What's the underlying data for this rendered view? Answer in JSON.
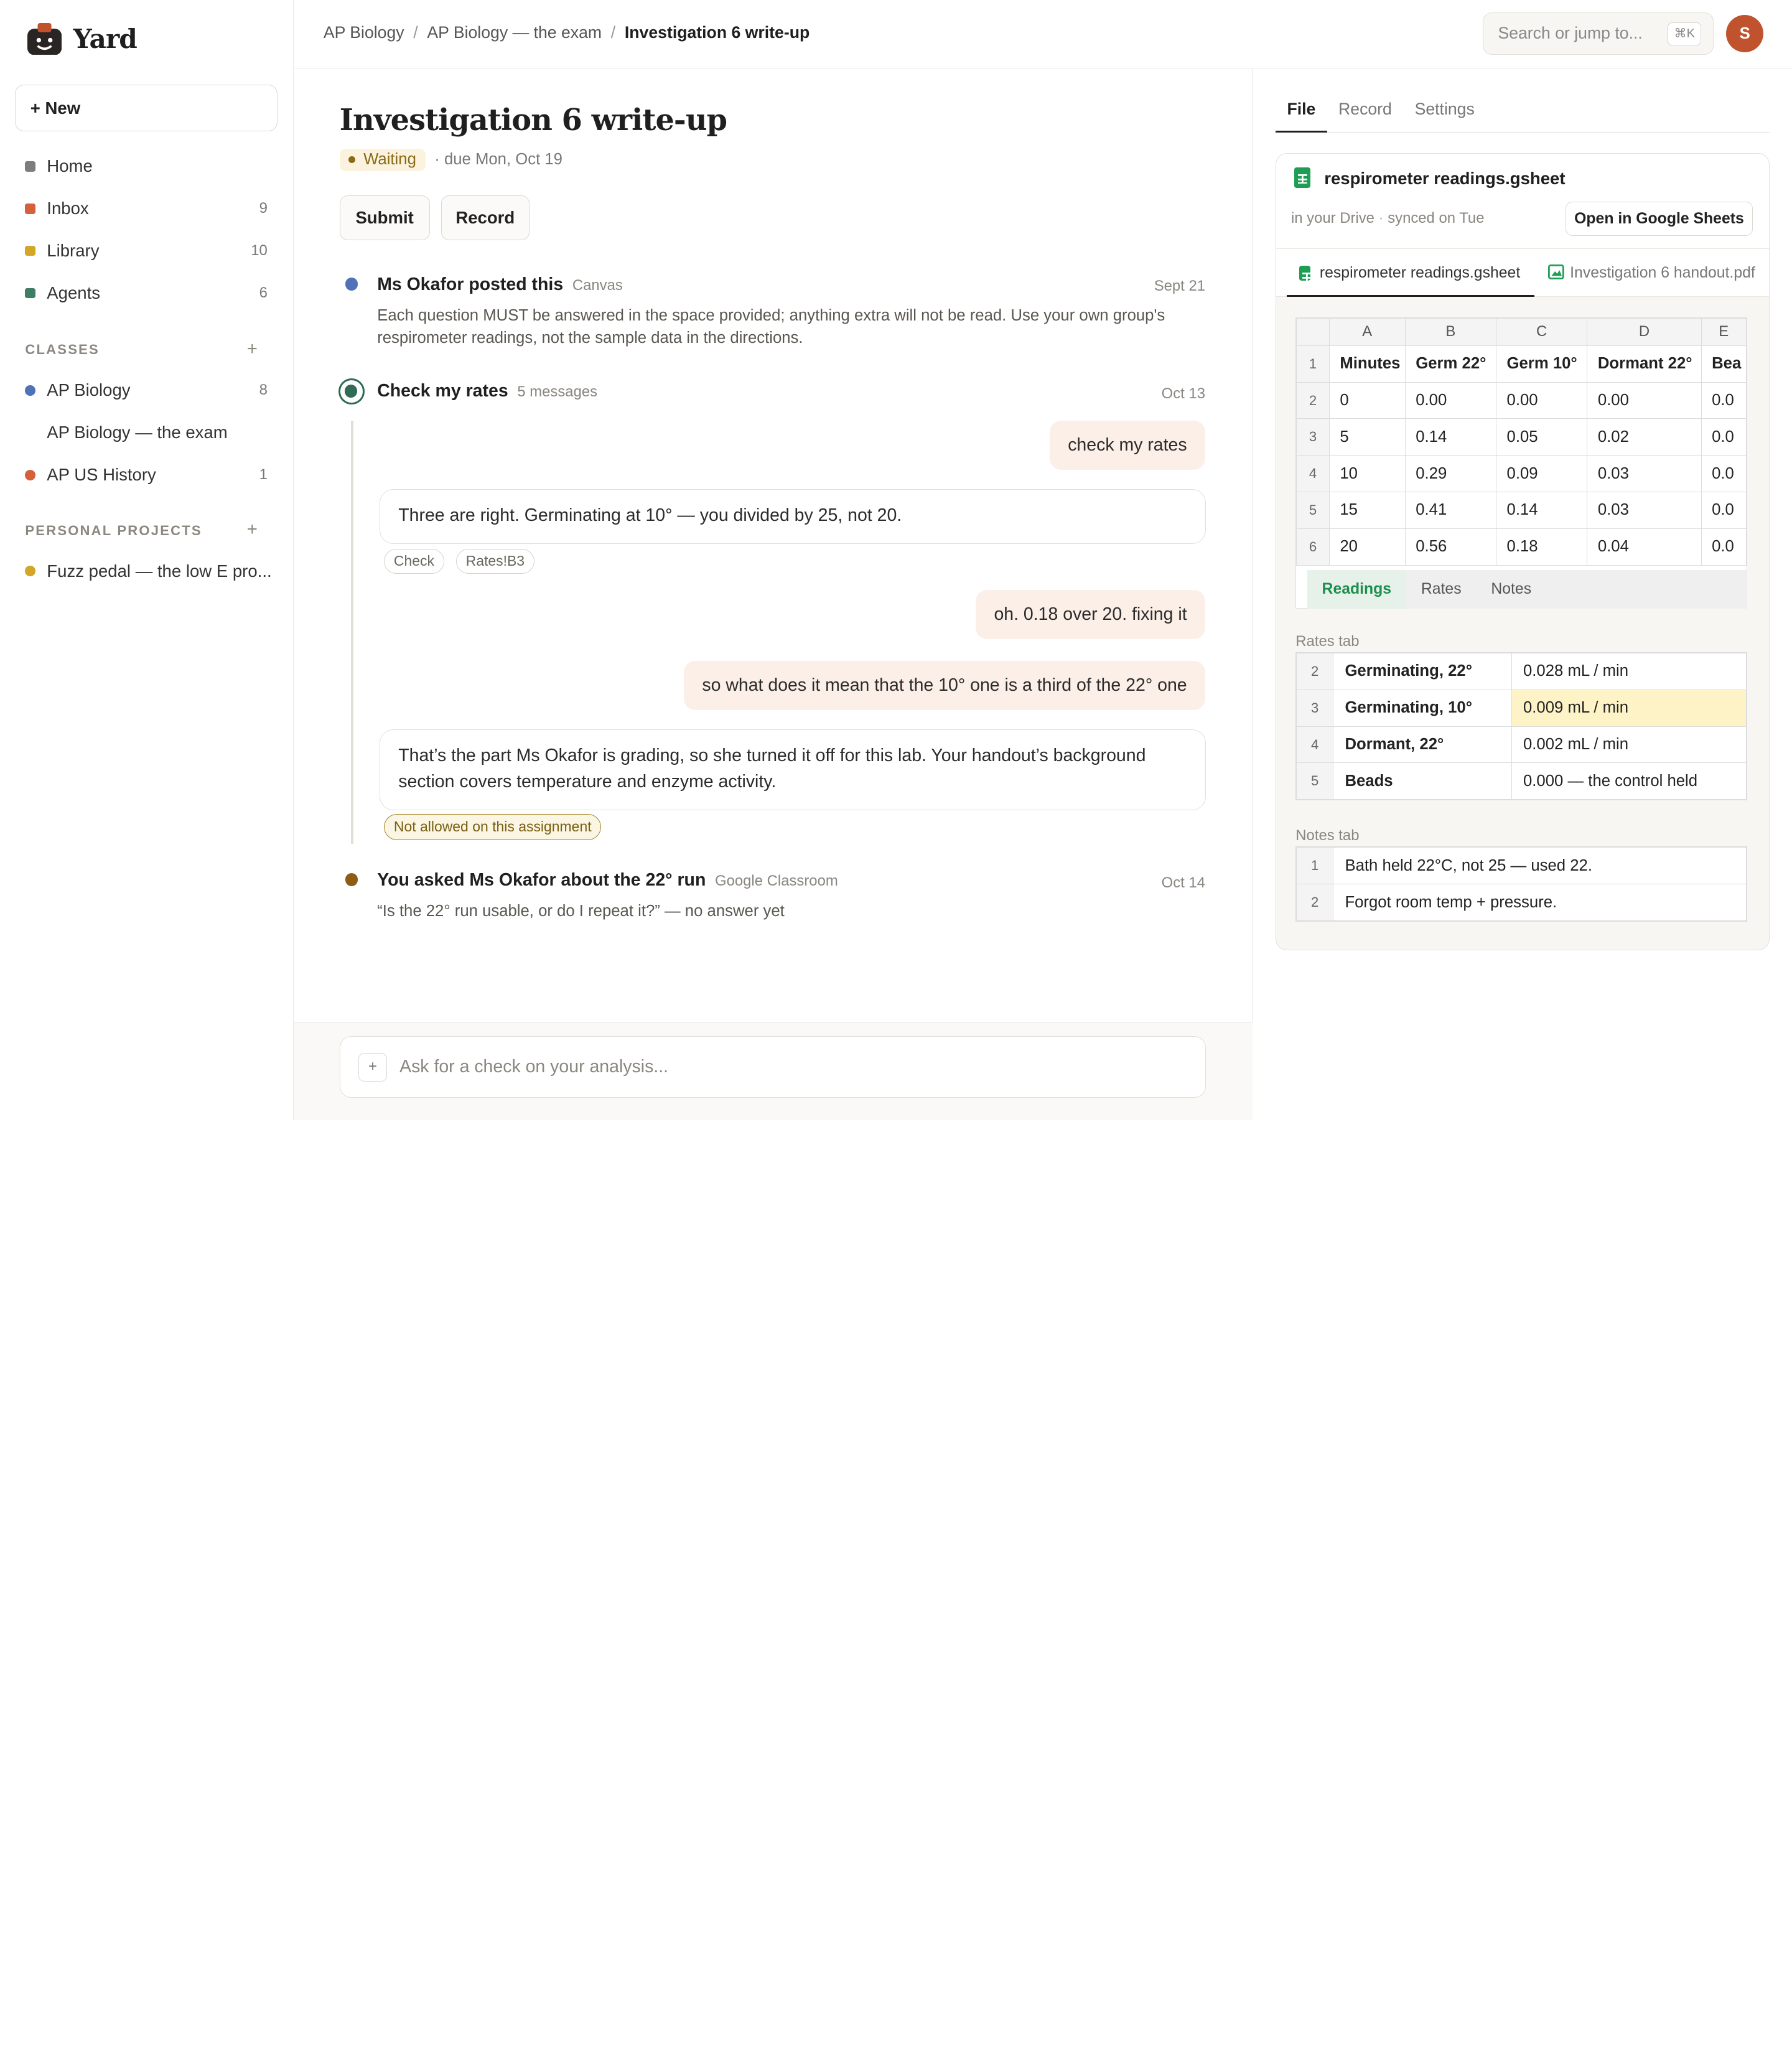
{
  "app": {
    "name": "Yard"
  },
  "sidebar": {
    "new_label": "+ New",
    "items": [
      {
        "label": "Home",
        "count": "",
        "color": "#7d7d7d"
      },
      {
        "label": "Inbox",
        "count": "9",
        "color": "#d4603c"
      },
      {
        "label": "Library",
        "count": "10",
        "color": "#d2a626"
      },
      {
        "label": "Agents",
        "count": "6",
        "color": "#3f7d64"
      }
    ],
    "classes_heading": "CLASSES",
    "classes": [
      {
        "label": "AP Biology",
        "count": "8",
        "color": "#4f72b8"
      },
      {
        "label": "AP Biology — the exam",
        "count": ""
      },
      {
        "label": "AP US History",
        "count": "1",
        "color": "#d4603c"
      }
    ],
    "projects_heading": "PERSONAL PROJECTS",
    "projects": [
      {
        "label": "Fuzz pedal — the low E pro...",
        "color": "#d2a626"
      }
    ]
  },
  "topbar": {
    "breadcrumb": [
      "AP Biology",
      "AP Biology — the exam",
      "Investigation 6 write-up"
    ],
    "separator": "/",
    "search_placeholder": "Search or jump to...",
    "search_shortcut": "⌘K",
    "avatar_initial": "S"
  },
  "main": {
    "title": "Investigation 6 write-up",
    "status": "Waiting",
    "due": "· due Mon, Oct 19",
    "submit_label": "Submit",
    "record_label": "Record",
    "events": {
      "posted": {
        "title": "Ms Okafor posted this",
        "source": "Canvas",
        "date": "Sept 21",
        "body": "Each question MUST be answered in the space provided; anything extra will not be read. Use your own group's respirometer readings, not the sample data in the directions."
      },
      "check": {
        "title": "Check my rates",
        "meta": "5 messages",
        "date": "Oct 13"
      },
      "asked": {
        "title": "You asked Ms Okafor about the 22° run",
        "source": "Google Classroom",
        "date": "Oct 14",
        "body": "“Is the 22° run usable, or do I repeat it?” — no answer yet"
      }
    },
    "messages": {
      "user1": "check my rates",
      "ai1": "Three are right. Germinating at 10° — you divided by 25, not 20.",
      "chip_check": "Check",
      "chip_ref": "Rates!B3",
      "user2": "oh. 0.18 over 20. fixing it",
      "user3": "so what does it mean that the 10° one is a third of the 22° one",
      "ai2": "That’s the part Ms Okafor is grading, so she turned it off for this lab. Your handout’s background section covers temperature and enzyme activity.",
      "chip_warn": "Not allowed on this assignment"
    },
    "composer_placeholder": "Ask for a check on your analysis...",
    "composer_plus": "+"
  },
  "panel": {
    "tabs": [
      "File",
      "Record",
      "Settings"
    ],
    "file": {
      "name": "respirometer readings.gsheet",
      "location": "in your Drive",
      "synced": "synced on Tue",
      "open_label": "Open in Google Sheets",
      "file_tabs": [
        "respirometer readings.gsheet",
        "Investigation 6 handout.pdf"
      ]
    },
    "sheet": {
      "columns": [
        "A",
        "B",
        "C",
        "D",
        "E"
      ],
      "rows": [
        {
          "n": "1",
          "cells": [
            "Minutes",
            "Germ 22°",
            "Germ 10°",
            "Dormant 22°",
            "Bea"
          ]
        },
        {
          "n": "2",
          "cells": [
            "0",
            "0.00",
            "0.00",
            "0.00",
            "0.0"
          ]
        },
        {
          "n": "3",
          "cells": [
            "5",
            "0.14",
            "0.05",
            "0.02",
            "0.0"
          ]
        },
        {
          "n": "4",
          "cells": [
            "10",
            "0.29",
            "0.09",
            "0.03",
            "0.0"
          ]
        },
        {
          "n": "5",
          "cells": [
            "15",
            "0.41",
            "0.14",
            "0.03",
            "0.0"
          ]
        },
        {
          "n": "6",
          "cells": [
            "20",
            "0.56",
            "0.18",
            "0.04",
            "0.0"
          ]
        }
      ],
      "tabs": [
        "Readings",
        "Rates",
        "Notes"
      ]
    },
    "rates": {
      "heading": "Rates tab",
      "rows": [
        {
          "n": "2",
          "k": "Germinating, 22°",
          "v": "0.028 mL / min"
        },
        {
          "n": "3",
          "k": "Germinating, 10°",
          "v": "0.009 mL / min"
        },
        {
          "n": "4",
          "k": "Dormant, 22°",
          "v": "0.002 mL / min"
        },
        {
          "n": "5",
          "k": "Beads",
          "v": "0.000 — the control held"
        }
      ]
    },
    "notes": {
      "heading": "Notes tab",
      "rows": [
        {
          "n": "1",
          "v": "Bath held 22°C, not 25 — used 22."
        },
        {
          "n": "2",
          "v": "Forgot room temp + pressure."
        }
      ]
    }
  }
}
